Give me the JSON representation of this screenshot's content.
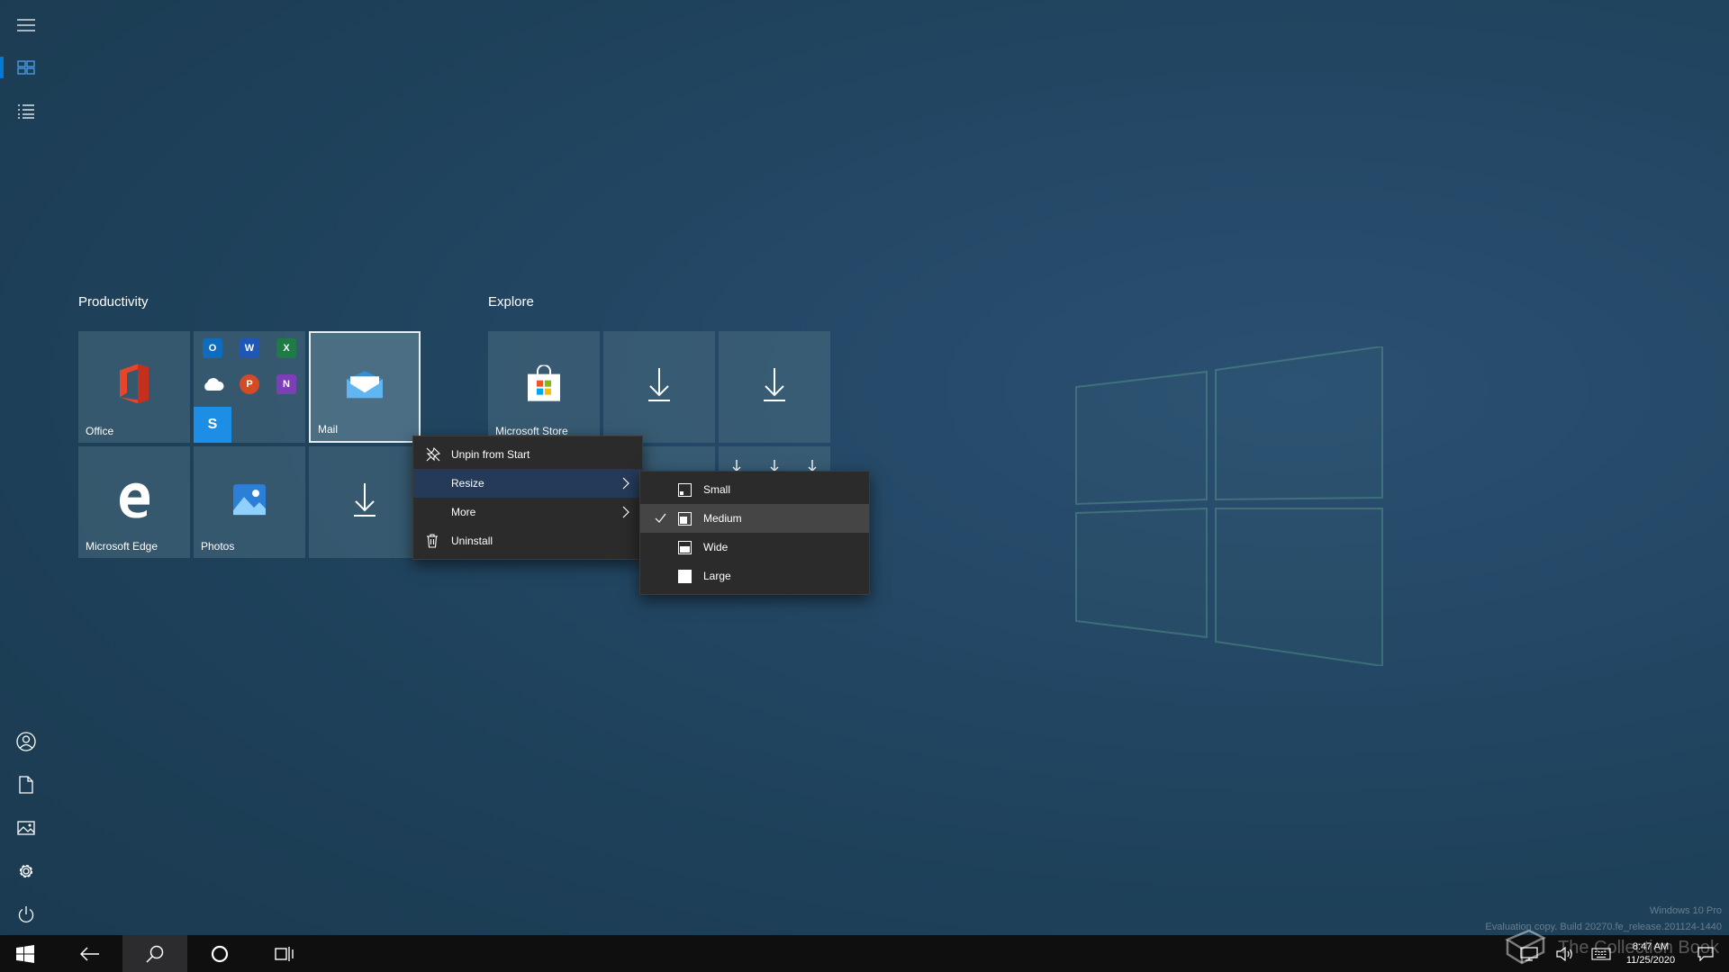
{
  "groups": {
    "productivity": "Productivity",
    "explore": "Explore"
  },
  "tiles": {
    "office": "Office",
    "mail": "Mail",
    "edge": "Microsoft Edge",
    "photos": "Photos",
    "store": "Microsoft Store"
  },
  "office_apps": {
    "outlook": "O",
    "word": "W",
    "excel": "X",
    "powerpoint": "P",
    "onenote": "N",
    "skype": "S"
  },
  "context_menu": {
    "unpin": "Unpin from Start",
    "resize": "Resize",
    "more": "More",
    "uninstall": "Uninstall"
  },
  "resize_menu": {
    "selected": "Medium",
    "small": "Small",
    "medium": "Medium",
    "wide": "Wide",
    "large": "Large"
  },
  "clock": {
    "time": "8:47 AM",
    "date": "11/25/2020"
  },
  "watermark": {
    "edition": "Windows 10 Pro",
    "build": "Evaluation copy. Build 20270.fe_release.201124-1440",
    "overlay": "The Collection Book"
  },
  "colors": {
    "accent": "#0078d7",
    "menu_bg": "#2b2b2b",
    "taskbar_bg": "#0f0f10",
    "tile_bg": "#486c80"
  }
}
